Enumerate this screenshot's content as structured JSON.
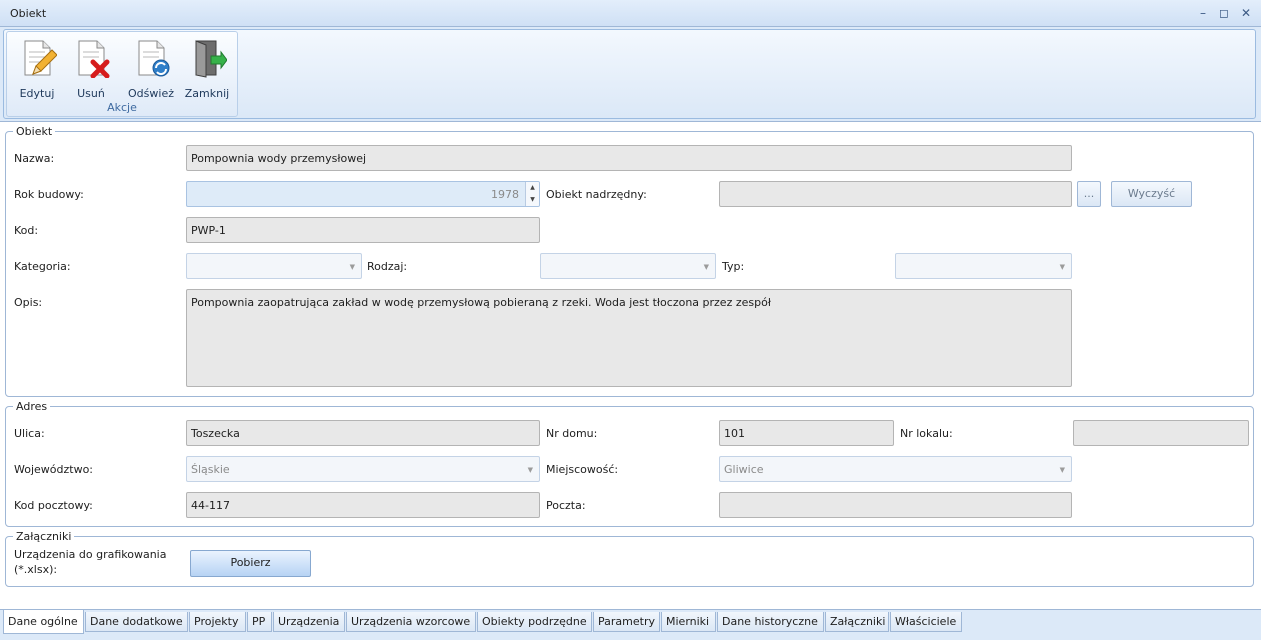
{
  "window": {
    "title": "Obiekt"
  },
  "ribbon": {
    "buttons": [
      {
        "label": "Edytuj",
        "icon": "edit-icon"
      },
      {
        "label": "Usuń",
        "icon": "delete-icon"
      },
      {
        "label": "Odśwież",
        "icon": "refresh-icon"
      },
      {
        "label": "Zamknij",
        "icon": "exit-door-icon"
      }
    ],
    "group_caption": "Akcje"
  },
  "obiekt": {
    "legend": "Obiekt",
    "nazwa_label": "Nazwa:",
    "nazwa_value": "Pompownia wody przemysłowej",
    "rok_label": "Rok budowy:",
    "rok_value": "1978",
    "nadrzedny_label": "Obiekt nadrzędny:",
    "nadrzedny_value": "",
    "browse_label": "...",
    "clear_label": "Wyczyść",
    "kod_label": "Kod:",
    "kod_value": "PWP-1",
    "kategoria_label": "Kategoria:",
    "kategoria_value": "",
    "rodzaj_label": "Rodzaj:",
    "rodzaj_value": "",
    "typ_label": "Typ:",
    "typ_value": "",
    "opis_label": "Opis:",
    "opis_value": "Pompownia zaopatrująca zakład w wodę przemysłową pobieraną z rzeki. Woda jest tłoczona przez zespół"
  },
  "adres": {
    "legend": "Adres",
    "ulica_label": "Ulica:",
    "ulica_value": "Toszecka",
    "nr_domu_label": "Nr domu:",
    "nr_domu_value": "101",
    "nr_lokalu_label": "Nr lokalu:",
    "nr_lokalu_value": "",
    "wojewodztwo_label": "Województwo:",
    "wojewodztwo_value": "Śląskie",
    "miejscowosc_label": "Miejscowość:",
    "miejscowosc_value": "Gliwice",
    "kod_label": "Kod pocztowy:",
    "kod_value": "44-117",
    "poczta_label": "Poczta:",
    "poczta_value": ""
  },
  "zalaczniki": {
    "legend": "Załączniki",
    "label_line1": "Urządzenia do grafikowania",
    "label_line2": "(*.xlsx):",
    "button": "Pobierz"
  },
  "tabs": [
    "Dane ogólne",
    "Dane dodatkowe",
    "Projekty",
    "PP",
    "Urządzenia",
    "Urządzenia wzorcowe",
    "Obiekty podrzędne",
    "Parametry",
    "Mierniki",
    "Dane historyczne",
    "Załączniki",
    "Właściciele"
  ]
}
